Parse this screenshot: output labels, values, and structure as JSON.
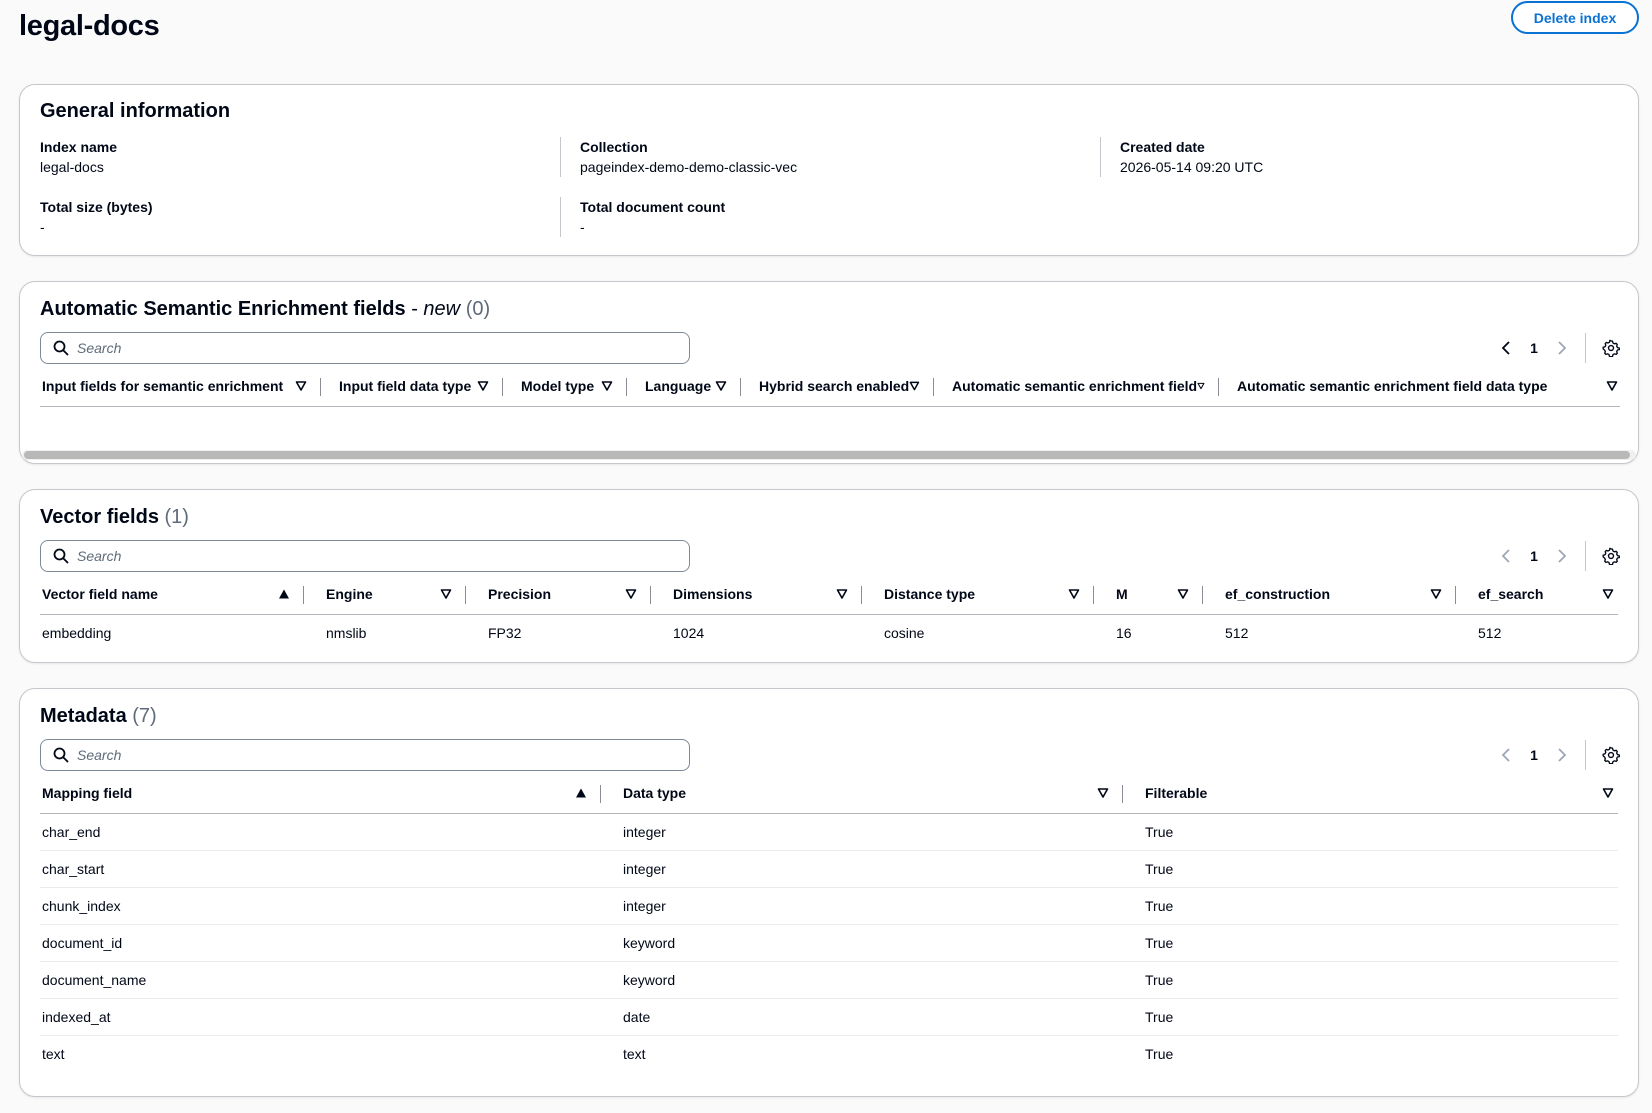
{
  "page": {
    "title": "legal-docs",
    "delete_button": "Delete index"
  },
  "general": {
    "title": "General information",
    "fields": [
      {
        "label": "Index name",
        "value": "legal-docs"
      },
      {
        "label": "Collection",
        "value": "pageindex-demo-demo-classic-vec"
      },
      {
        "label": "Created date",
        "value": "2026-05-14 09:20 UTC"
      },
      {
        "label": "Total size (bytes)",
        "value": "-"
      },
      {
        "label": "Total document count",
        "value": "-"
      }
    ]
  },
  "ase": {
    "title": "Automatic Semantic Enrichment fields",
    "title_sep": " - ",
    "title_new": "new",
    "count": "(0)",
    "search_placeholder": "Search",
    "page_number": "1",
    "columns": [
      "Input fields for semantic enrichment",
      "Input field data type",
      "Model type",
      "Language",
      "Hybrid search enabled",
      "Automatic semantic enrichment field",
      "Automatic semantic enrichment field data type"
    ]
  },
  "vector": {
    "title": "Vector fields",
    "count": "(1)",
    "search_placeholder": "Search",
    "page_number": "1",
    "columns": [
      "Vector field name",
      "Engine",
      "Precision",
      "Dimensions",
      "Distance type",
      "M",
      "ef_construction",
      "ef_search"
    ],
    "rows": [
      [
        "embedding",
        "nmslib",
        "FP32",
        "1024",
        "cosine",
        "16",
        "512",
        "512"
      ]
    ]
  },
  "metadata": {
    "title": "Metadata",
    "count": "(7)",
    "search_placeholder": "Search",
    "page_number": "1",
    "columns": [
      "Mapping field",
      "Data type",
      "Filterable"
    ],
    "rows": [
      [
        "char_end",
        "integer",
        "True"
      ],
      [
        "char_start",
        "integer",
        "True"
      ],
      [
        "chunk_index",
        "integer",
        "True"
      ],
      [
        "document_id",
        "keyword",
        "True"
      ],
      [
        "document_name",
        "keyword",
        "True"
      ],
      [
        "indexed_at",
        "date",
        "True"
      ],
      [
        "text",
        "text",
        "True"
      ]
    ]
  },
  "icons": {
    "search": "search-icon",
    "prev": "chevron-left-icon",
    "next": "chevron-right-icon",
    "settings": "gear-icon",
    "sort_asc": "sort-ascending-icon",
    "sort_none": "sort-caret-down-icon"
  },
  "colors": {
    "accent": "#0972d3",
    "text": "#000716",
    "muted": "#5f6b7a",
    "border": "#c6c6cd"
  }
}
